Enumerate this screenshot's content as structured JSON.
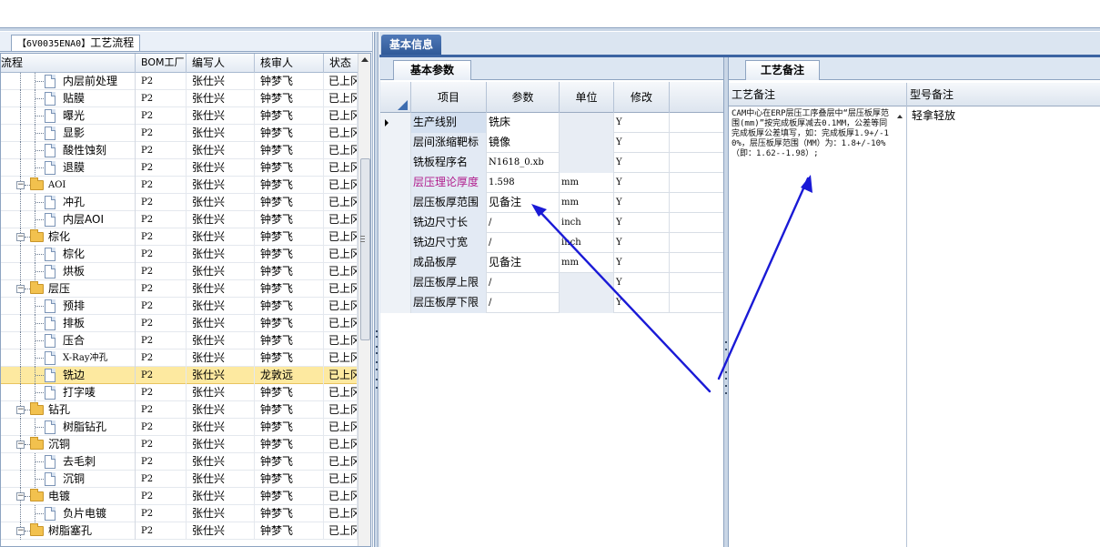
{
  "left_panel": {
    "tab_label_code": "【6V0035ENA0】",
    "tab_label_text": "工艺流程",
    "columns": [
      "流程",
      "BOM工厂",
      "编写人",
      "核审人",
      "状态"
    ],
    "rows": [
      {
        "name": "内层前处理",
        "kind": "doc",
        "level": 2,
        "bom": "P2",
        "writer": "张仕兴",
        "reviewer": "钟梦飞",
        "status": "已上冈"
      },
      {
        "name": "贴膜",
        "kind": "doc",
        "level": 2,
        "bom": "P2",
        "writer": "张仕兴",
        "reviewer": "钟梦飞",
        "status": "已上冈"
      },
      {
        "name": "曝光",
        "kind": "doc",
        "level": 2,
        "bom": "P2",
        "writer": "张仕兴",
        "reviewer": "钟梦飞",
        "status": "已上冈"
      },
      {
        "name": "显影",
        "kind": "doc",
        "level": 2,
        "bom": "P2",
        "writer": "张仕兴",
        "reviewer": "钟梦飞",
        "status": "已上冈"
      },
      {
        "name": "酸性蚀刻",
        "kind": "doc",
        "level": 2,
        "bom": "P2",
        "writer": "张仕兴",
        "reviewer": "钟梦飞",
        "status": "已上冈"
      },
      {
        "name": "退膜",
        "kind": "doc",
        "level": 2,
        "bom": "P2",
        "writer": "张仕兴",
        "reviewer": "钟梦飞",
        "status": "已上冈"
      },
      {
        "name": "AOI",
        "kind": "folder",
        "level": 1,
        "bom": "P2",
        "writer": "张仕兴",
        "reviewer": "钟梦飞",
        "status": "已上冈"
      },
      {
        "name": "冲孔",
        "kind": "doc",
        "level": 2,
        "bom": "P2",
        "writer": "张仕兴",
        "reviewer": "钟梦飞",
        "status": "已上冈"
      },
      {
        "name": "内层AOI",
        "kind": "doc",
        "level": 2,
        "bom": "P2",
        "writer": "张仕兴",
        "reviewer": "钟梦飞",
        "status": "已上冈"
      },
      {
        "name": "棕化",
        "kind": "folder",
        "level": 1,
        "bom": "P2",
        "writer": "张仕兴",
        "reviewer": "钟梦飞",
        "status": "已上冈"
      },
      {
        "name": "棕化",
        "kind": "doc",
        "level": 2,
        "bom": "P2",
        "writer": "张仕兴",
        "reviewer": "钟梦飞",
        "status": "已上冈"
      },
      {
        "name": "烘板",
        "kind": "doc",
        "level": 2,
        "bom": "P2",
        "writer": "张仕兴",
        "reviewer": "钟梦飞",
        "status": "已上冈"
      },
      {
        "name": "层压",
        "kind": "folder",
        "level": 1,
        "bom": "P2",
        "writer": "张仕兴",
        "reviewer": "钟梦飞",
        "status": "已上冈"
      },
      {
        "name": "预排",
        "kind": "doc",
        "level": 2,
        "bom": "P2",
        "writer": "张仕兴",
        "reviewer": "钟梦飞",
        "status": "已上冈"
      },
      {
        "name": "排板",
        "kind": "doc",
        "level": 2,
        "bom": "P2",
        "writer": "张仕兴",
        "reviewer": "钟梦飞",
        "status": "已上冈"
      },
      {
        "name": "压合",
        "kind": "doc",
        "level": 2,
        "bom": "P2",
        "writer": "张仕兴",
        "reviewer": "钟梦飞",
        "status": "已上冈"
      },
      {
        "name": "X-Ray冲孔",
        "kind": "doc",
        "level": 2,
        "bom": "P2",
        "writer": "张仕兴",
        "reviewer": "钟梦飞",
        "status": "已上冈"
      },
      {
        "name": "铣边",
        "kind": "doc",
        "level": 2,
        "bom": "P2",
        "writer": "张仕兴",
        "reviewer": "龙敦远",
        "status": "已上冈",
        "selected": true
      },
      {
        "name": "打字唛",
        "kind": "doc",
        "level": 2,
        "bom": "P2",
        "writer": "张仕兴",
        "reviewer": "钟梦飞",
        "status": "已上冈"
      },
      {
        "name": "钻孔",
        "kind": "folder",
        "level": 1,
        "bom": "P2",
        "writer": "张仕兴",
        "reviewer": "钟梦飞",
        "status": "已上冈"
      },
      {
        "name": "树脂钻孔",
        "kind": "doc",
        "level": 2,
        "bom": "P2",
        "writer": "张仕兴",
        "reviewer": "钟梦飞",
        "status": "已上冈"
      },
      {
        "name": "沉铜",
        "kind": "folder",
        "level": 1,
        "bom": "P2",
        "writer": "张仕兴",
        "reviewer": "钟梦飞",
        "status": "已上冈"
      },
      {
        "name": "去毛刺",
        "kind": "doc",
        "level": 2,
        "bom": "P2",
        "writer": "张仕兴",
        "reviewer": "钟梦飞",
        "status": "已上冈"
      },
      {
        "name": "沉铜",
        "kind": "doc",
        "level": 2,
        "bom": "P2",
        "writer": "张仕兴",
        "reviewer": "钟梦飞",
        "status": "已上冈"
      },
      {
        "name": "电镀",
        "kind": "folder",
        "level": 1,
        "bom": "P2",
        "writer": "张仕兴",
        "reviewer": "钟梦飞",
        "status": "已上冈"
      },
      {
        "name": "负片电镀",
        "kind": "doc",
        "level": 2,
        "bom": "P2",
        "writer": "张仕兴",
        "reviewer": "钟梦飞",
        "status": "已上冈"
      },
      {
        "name": "树脂塞孔",
        "kind": "folder",
        "level": 1,
        "bom": "P2",
        "writer": "张仕兴",
        "reviewer": "钟梦飞",
        "status": "已上冈"
      }
    ]
  },
  "main_tab": "基本信息",
  "basic_params": {
    "tab": "基本参数",
    "columns": [
      "项目",
      "参数",
      "单位",
      "修改"
    ],
    "rows": [
      {
        "item": "生产线别",
        "value": "铣床",
        "unit": "",
        "mod": "Y",
        "current": true
      },
      {
        "item": "层间涨缩靶标",
        "value": "镜像",
        "unit": "",
        "mod": "Y"
      },
      {
        "item": "铣板程序名",
        "value": "N1618_0.xb",
        "unit": "",
        "mod": "Y"
      },
      {
        "item": "层压理论厚度",
        "value": "1.598",
        "unit": "mm",
        "mod": "Y",
        "highlight": true
      },
      {
        "item": "层压板厚范围",
        "value": "见备注",
        "unit": "mm",
        "mod": "Y"
      },
      {
        "item": "铣边尺寸长",
        "value": "/",
        "unit": "inch",
        "mod": "Y"
      },
      {
        "item": "铣边尺寸宽",
        "value": "/",
        "unit": "inch",
        "mod": "Y"
      },
      {
        "item": "成品板厚",
        "value": "见备注",
        "unit": "mm",
        "mod": "Y"
      },
      {
        "item": "层压板厚上限",
        "value": "/",
        "unit": "",
        "mod": "Y"
      },
      {
        "item": "层压板厚下限",
        "value": "/",
        "unit": "",
        "mod": "Y"
      }
    ]
  },
  "process_notes": {
    "tab": "工艺备注",
    "col1": "工艺备注",
    "col2": "型号备注",
    "note_text": "CAM中心在ERP层压工序叠层中“层压板厚范围(mm)”按完成板厚减去0.1MM，公差等同完成板厚公差填写，如：完成板厚1.9+/-10%，层压板厚范围（MM）为：1.8+/-10%（即：1.62--1.98）;",
    "model_note": "轻拿轻放"
  },
  "colors": {
    "annotation_arrow": "#1a1ad6",
    "tab_blue": "#2f5896",
    "selected_row": "#fde9a0",
    "highlight_text": "#b01c8c"
  }
}
